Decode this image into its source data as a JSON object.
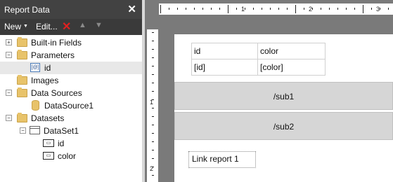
{
  "panel": {
    "title": "Report Data",
    "close_glyph": "✕",
    "toolbar": {
      "new_label": "New",
      "new_caret": "▼",
      "edit_label": "Edit...",
      "delete_icon": "delete-icon",
      "move_up_icon": "arrow-up-icon",
      "move_down_icon": "arrow-down-icon"
    },
    "tree": {
      "built_in_fields": "Built-in Fields",
      "parameters": "Parameters",
      "param_id": "id",
      "images": "Images",
      "data_sources": "Data Sources",
      "datasource1": "DataSource1",
      "datasets": "Datasets",
      "dataset1": "DataSet1",
      "field_id": "id",
      "field_color": "color"
    }
  },
  "designer": {
    "ruler_top_numbers": [
      "1",
      "2",
      "3"
    ],
    "ruler_left_numbers": [
      "1",
      "2"
    ],
    "table": {
      "headers": [
        "id",
        "color"
      ],
      "cells": [
        "[id]",
        "[color]"
      ]
    },
    "subreport1": "/sub1",
    "subreport2": "/sub2",
    "link_text": "Link report 1"
  }
}
